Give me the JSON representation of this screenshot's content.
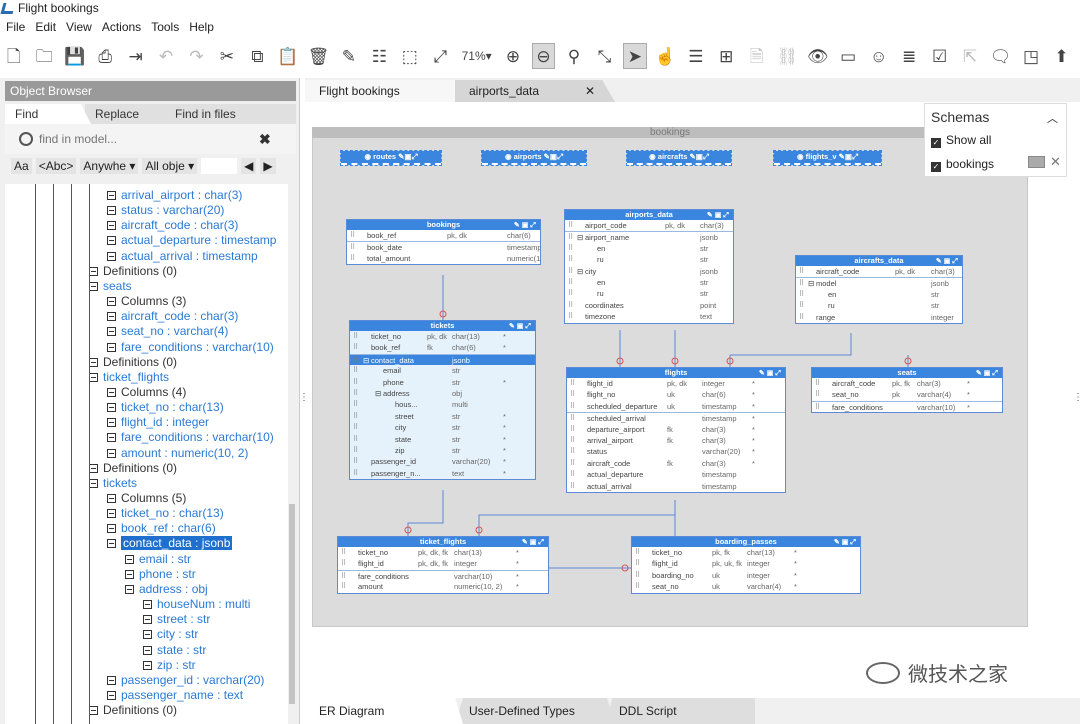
{
  "window": {
    "title": "Flight bookings"
  },
  "menu": [
    "File",
    "Edit",
    "View",
    "Actions",
    "Tools",
    "Help"
  ],
  "toolbar": {
    "zoom": "71%"
  },
  "object_browser": {
    "title": "Object Browser",
    "tabs": [
      "Find",
      "Replace",
      "Find in files"
    ],
    "search_placeholder": "find in model...",
    "filters": [
      "Aa",
      "<Abc>",
      "Anywhe",
      "All obje"
    ]
  },
  "tree": [
    {
      "label": "arrival_airport : char(3)",
      "blue": true
    },
    {
      "label": "status : varchar(20)",
      "blue": true
    },
    {
      "label": "aircraft_code : char(3)",
      "blue": true
    },
    {
      "label": "actual_departure : timestamp",
      "blue": true
    },
    {
      "label": "actual_arrival : timestamp",
      "blue": true
    },
    {
      "label": "Definitions (0)",
      "blue": false
    },
    {
      "label": "seats",
      "blue": true
    },
    {
      "label": "Columns (3)",
      "blue": false
    },
    {
      "label": "aircraft_code : char(3)",
      "blue": true
    },
    {
      "label": "seat_no : varchar(4)",
      "blue": true
    },
    {
      "label": "fare_conditions : varchar(10)",
      "blue": true
    },
    {
      "label": "Definitions (0)",
      "blue": false
    },
    {
      "label": "ticket_flights",
      "blue": true
    },
    {
      "label": "Columns (4)",
      "blue": false
    },
    {
      "label": "ticket_no : char(13)",
      "blue": true
    },
    {
      "label": "flight_id : integer",
      "blue": true
    },
    {
      "label": "fare_conditions : varchar(10)",
      "blue": true
    },
    {
      "label": "amount : numeric(10, 2)",
      "blue": true
    },
    {
      "label": "Definitions (0)",
      "blue": false
    },
    {
      "label": "tickets",
      "blue": true
    },
    {
      "label": "Columns (5)",
      "blue": false
    },
    {
      "label": "ticket_no : char(13)",
      "blue": true
    },
    {
      "label": "book_ref : char(6)",
      "blue": true
    },
    {
      "label": "contact_data : jsonb",
      "blue": true,
      "selected": true
    },
    {
      "label": "email : str",
      "blue": true
    },
    {
      "label": "phone : str",
      "blue": true
    },
    {
      "label": "address : obj",
      "blue": true
    },
    {
      "label": "houseNum : multi",
      "blue": true
    },
    {
      "label": "street : str",
      "blue": true
    },
    {
      "label": "city : str",
      "blue": true
    },
    {
      "label": "state : str",
      "blue": true
    },
    {
      "label": "zip : str",
      "blue": true
    },
    {
      "label": "passenger_id : varchar(20)",
      "blue": true
    },
    {
      "label": "passenger_name : text",
      "blue": true
    },
    {
      "label": "Definitions (0)",
      "blue": false
    }
  ],
  "doc_tabs": [
    "Flight bookings",
    "airports_data"
  ],
  "diagram": {
    "schema_label": "bookings",
    "views": [
      "routes",
      "airports",
      "aircrafts",
      "flights_v"
    ],
    "entities": {
      "bookings": {
        "title": "bookings",
        "rows": [
          [
            "book_ref",
            "pk, dk",
            "char(6)",
            "*"
          ],
          [
            "book_date",
            "",
            "timestamp",
            "*"
          ],
          [
            "total_amount",
            "",
            "numeric(10, 2)",
            "*"
          ]
        ]
      },
      "airports_data": {
        "title": "airports_data",
        "rows": [
          [
            "airport_code",
            "pk, dk",
            "char(3)",
            "*"
          ],
          [
            "airport_name",
            "",
            "jsonb",
            "*"
          ],
          [
            "en",
            "",
            "str",
            "*"
          ],
          [
            "ru",
            "",
            "str",
            "*"
          ],
          [
            "city",
            "",
            "jsonb",
            "*"
          ],
          [
            "en",
            "",
            "str",
            "*"
          ],
          [
            "ru",
            "",
            "str",
            "*"
          ],
          [
            "coordinates",
            "",
            "point",
            "*"
          ],
          [
            "timezone",
            "",
            "text",
            "*"
          ]
        ]
      },
      "aircrafts_data": {
        "title": "aircrafts_data",
        "rows": [
          [
            "aircraft_code",
            "pk, dk",
            "char(3)",
            "*"
          ],
          [
            "model",
            "",
            "jsonb",
            "*"
          ],
          [
            "en",
            "",
            "str",
            "*"
          ],
          [
            "ru",
            "",
            "str",
            "*"
          ],
          [
            "range",
            "",
            "integer",
            "*"
          ]
        ]
      },
      "tickets": {
        "title": "tickets",
        "rows": [
          [
            "ticket_no",
            "pk, dk",
            "char(13)",
            "*"
          ],
          [
            "book_ref",
            "fk",
            "char(6)",
            "*"
          ],
          [
            "contact_data",
            "",
            "jsonb",
            ""
          ],
          [
            "email",
            "",
            "str",
            ""
          ],
          [
            "phone",
            "",
            "str",
            "*"
          ],
          [
            "address",
            "",
            "obj",
            ""
          ],
          [
            "hous...",
            "",
            "multi",
            ""
          ],
          [
            "street",
            "",
            "str",
            "*"
          ],
          [
            "city",
            "",
            "str",
            "*"
          ],
          [
            "state",
            "",
            "str",
            "*"
          ],
          [
            "zip",
            "",
            "str",
            "*"
          ],
          [
            "passenger_id",
            "",
            "varchar(20)",
            "*"
          ],
          [
            "passenger_n...",
            "",
            "text",
            "*"
          ]
        ]
      },
      "flights": {
        "title": "flights",
        "rows": [
          [
            "flight_id",
            "pk, dk",
            "integer",
            "*"
          ],
          [
            "flight_no",
            "uk",
            "char(6)",
            "*"
          ],
          [
            "scheduled_departure",
            "uk",
            "timestamp",
            "*"
          ],
          [
            "scheduled_arrival",
            "",
            "timestamp",
            "*"
          ],
          [
            "departure_airport",
            "fk",
            "char(3)",
            "*"
          ],
          [
            "arrival_airport",
            "fk",
            "char(3)",
            "*"
          ],
          [
            "status",
            "",
            "varchar(20)",
            "*"
          ],
          [
            "aircraft_code",
            "fk",
            "char(3)",
            "*"
          ],
          [
            "actual_departure",
            "",
            "timestamp",
            ""
          ],
          [
            "actual_arrival",
            "",
            "timestamp",
            ""
          ]
        ]
      },
      "seats": {
        "title": "seats",
        "rows": [
          [
            "aircraft_code",
            "pk, fk",
            "char(3)",
            "*"
          ],
          [
            "seat_no",
            "pk",
            "varchar(4)",
            "*"
          ],
          [
            "fare_conditions",
            "",
            "varchar(10)",
            "*"
          ]
        ]
      },
      "ticket_flights": {
        "title": "ticket_flights",
        "rows": [
          [
            "ticket_no",
            "pk, dk, fk",
            "char(13)",
            "*"
          ],
          [
            "flight_id",
            "pk, dk, fk",
            "integer",
            "*"
          ],
          [
            "fare_conditions",
            "",
            "varchar(10)",
            "*"
          ],
          [
            "amount",
            "",
            "numeric(10, 2)",
            "*"
          ]
        ]
      },
      "boarding_passes": {
        "title": "boarding_passes",
        "rows": [
          [
            "ticket_no",
            "pk, fk",
            "char(13)",
            "*"
          ],
          [
            "flight_id",
            "pk, uk, fk",
            "integer",
            "*"
          ],
          [
            "boarding_no",
            "uk",
            "integer",
            "*"
          ],
          [
            "seat_no",
            "uk",
            "varchar(4)",
            "*"
          ]
        ]
      }
    }
  },
  "schemas_panel": {
    "title": "Schemas",
    "show_all": "Show all",
    "items": [
      "bookings"
    ]
  },
  "bottom_tabs": [
    "ER Diagram",
    "User-Defined Types",
    "DDL Script"
  ],
  "watermark": "微技术之家"
}
